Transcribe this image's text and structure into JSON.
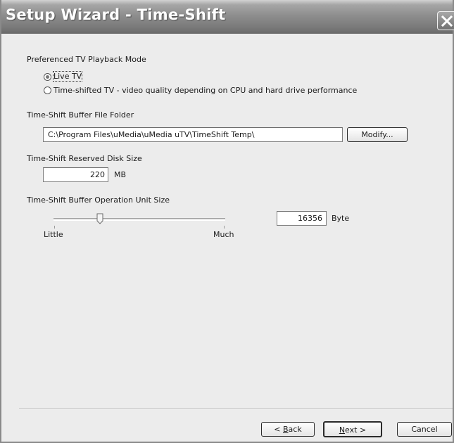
{
  "window": {
    "title": "Setup Wizard - Time-Shift"
  },
  "playback": {
    "heading": "Preferenced TV Playback Mode",
    "options": [
      {
        "label": "Live TV",
        "selected": true
      },
      {
        "label": "Time-shifted TV - video quality depending on CPU and hard drive performance",
        "selected": false
      }
    ]
  },
  "buffer_folder": {
    "heading": "Time-Shift Buffer File Folder",
    "path": "C:\\Program Files\\uMedia\\uMedia uTV\\TimeShift Temp\\",
    "modify_label": "Modify..."
  },
  "disk_size": {
    "heading": "Time-Shift Reserved Disk Size",
    "value": "220",
    "unit": "MB"
  },
  "unit_size": {
    "heading": "Time-Shift Buffer Operation Unit Size",
    "slider_fraction": 0.27,
    "min_label": "Little",
    "max_label": "Much",
    "value": "16356",
    "unit": "Byte"
  },
  "footer": {
    "back": {
      "prefix": "< ",
      "mnemonic": "B",
      "rest": "ack"
    },
    "next": {
      "mnemonic": "N",
      "rest": "ext >"
    },
    "cancel": "Cancel"
  },
  "colors": {
    "title_bar": "#8e8e8e",
    "dialog_background": "#ececec"
  }
}
